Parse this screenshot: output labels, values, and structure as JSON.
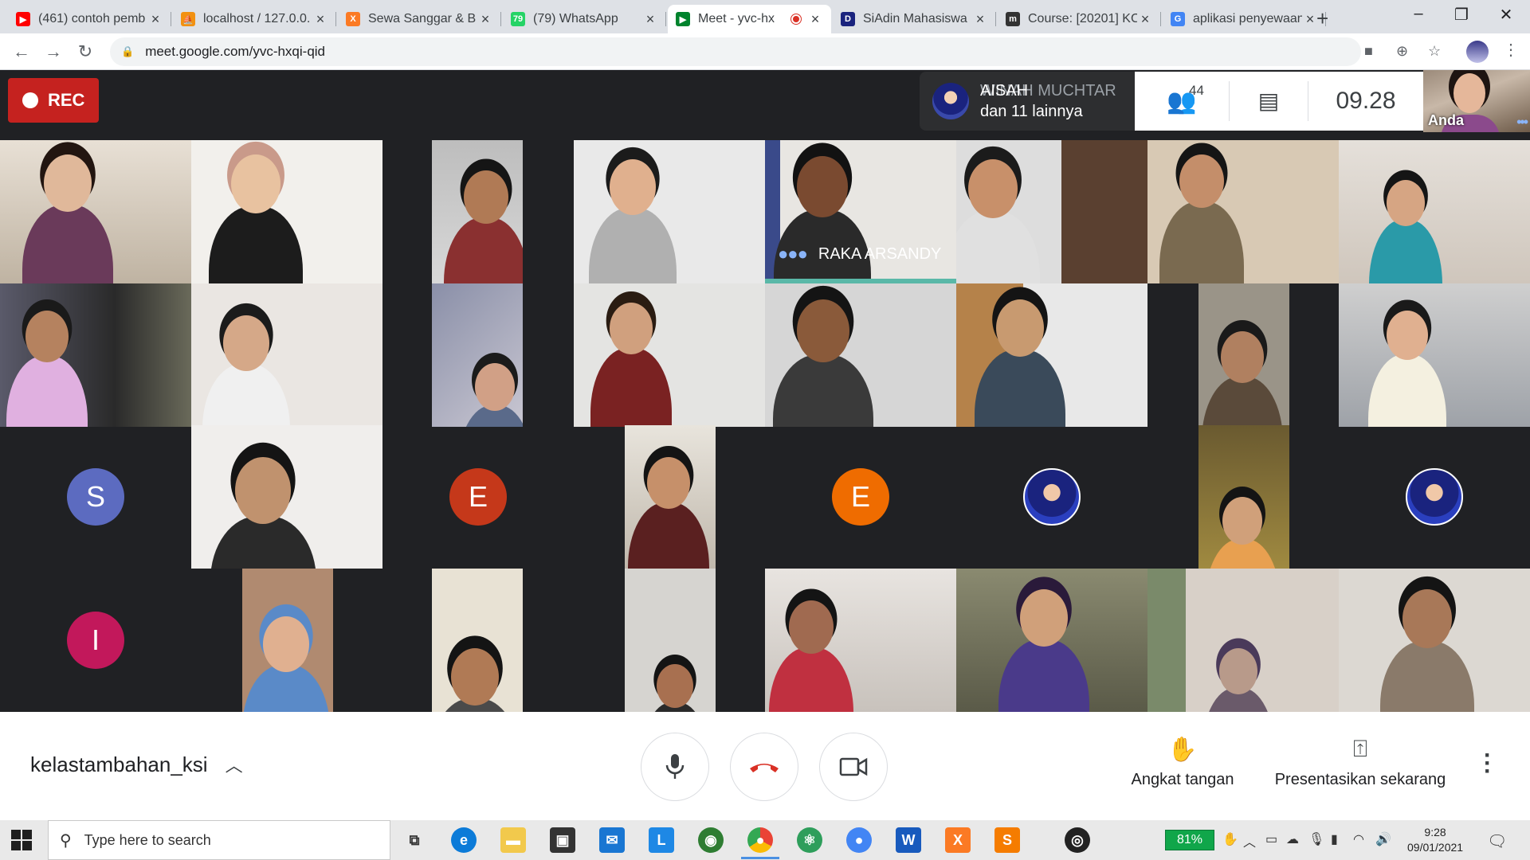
{
  "browser": {
    "tabs": [
      {
        "title": "(461) contoh pemb",
        "icon": "youtube-icon",
        "color": "#ff0000",
        "glyph": "▶",
        "active": false
      },
      {
        "title": "localhost / 127.0.0.",
        "icon": "phpmyadmin-icon",
        "color": "#f29111",
        "glyph": "⛵",
        "active": false
      },
      {
        "title": "Sewa Sanggar & B",
        "icon": "xampp-icon",
        "color": "#fb7a24",
        "glyph": "X",
        "active": false
      },
      {
        "title": "(79) WhatsApp",
        "icon": "whatsapp-icon",
        "color": "#25d366",
        "glyph": "79",
        "active": false
      },
      {
        "title": "Meet - yvc-hx",
        "icon": "google-meet-icon",
        "color": "#00832d",
        "glyph": "▶",
        "active": true,
        "recording": true
      },
      {
        "title": "SiAdin Mahasiswa",
        "icon": "siadin-icon",
        "color": "#1a237e",
        "glyph": "D",
        "active": false
      },
      {
        "title": "Course: [20201] KC",
        "icon": "moodle-icon",
        "color": "#333333",
        "glyph": "m",
        "active": false
      },
      {
        "title": "aplikasi penyewaan",
        "icon": "google-icon",
        "color": "#4285f4",
        "glyph": "G",
        "active": false
      }
    ],
    "new_tab": "+",
    "url": "meet.google.com/yvc-hxqi-qid"
  },
  "meet": {
    "rec_label": "REC",
    "speaker": {
      "name_overlap": "AISAH",
      "name": "WINAH MUCHTAR",
      "others": "dan 11 lainnya"
    },
    "participants_count": "44",
    "time": "09.28",
    "self_label": "Anda",
    "active_speaker_name": "RAKA ARSANDY",
    "avatar_letters": [
      {
        "letter": "S",
        "color": "#5c6bc0"
      },
      {
        "letter": "E",
        "color": "#c5381a"
      },
      {
        "letter": "E",
        "color": "#ef6c00"
      },
      {
        "letter": "I",
        "color": "#c2185b"
      }
    ],
    "meeting_name": "kelastambahan_ksi",
    "raise_hand": "Angkat tangan",
    "present_now": "Presentasikan sekarang"
  },
  "taskbar": {
    "search_placeholder": "Type here to search",
    "battery": "81%",
    "time": "9:28",
    "date": "09/01/2021"
  }
}
